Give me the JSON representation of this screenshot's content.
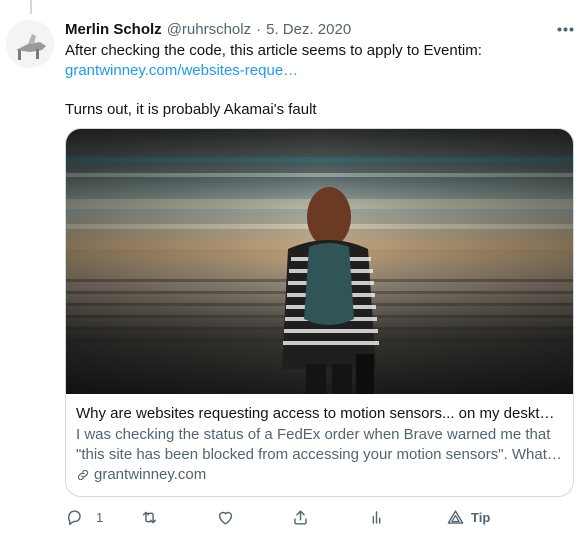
{
  "tweet": {
    "author_name": "Merlin Scholz",
    "author_handle": "@ruhrscholz",
    "separator": "·",
    "date": "5. Dez. 2020",
    "text_line1": "After checking the code, this article seems to apply to Eventim:",
    "link_text": "grantwinney.com/websites-reque…",
    "text_line2": "Turns out, it is probably Akamai's fault"
  },
  "card": {
    "title": "Why are websites requesting access to motion sensors... on my deskto…",
    "description": "I was checking the status of a FedEx order when Brave warned me that \"this site has been blocked from accessing your motion sensors\". What…",
    "domain": "grantwinney.com"
  },
  "actions": {
    "reply_count": "1",
    "tip_label": "Tip"
  },
  "colors": {
    "accent": "#1d9bf0",
    "secondary_text": "#536471",
    "border": "#cfd9de"
  },
  "icons": [
    "more-icon",
    "link-icon",
    "reply-icon",
    "retweet-icon",
    "like-icon",
    "share-icon",
    "analytics-icon",
    "tip-icon"
  ]
}
